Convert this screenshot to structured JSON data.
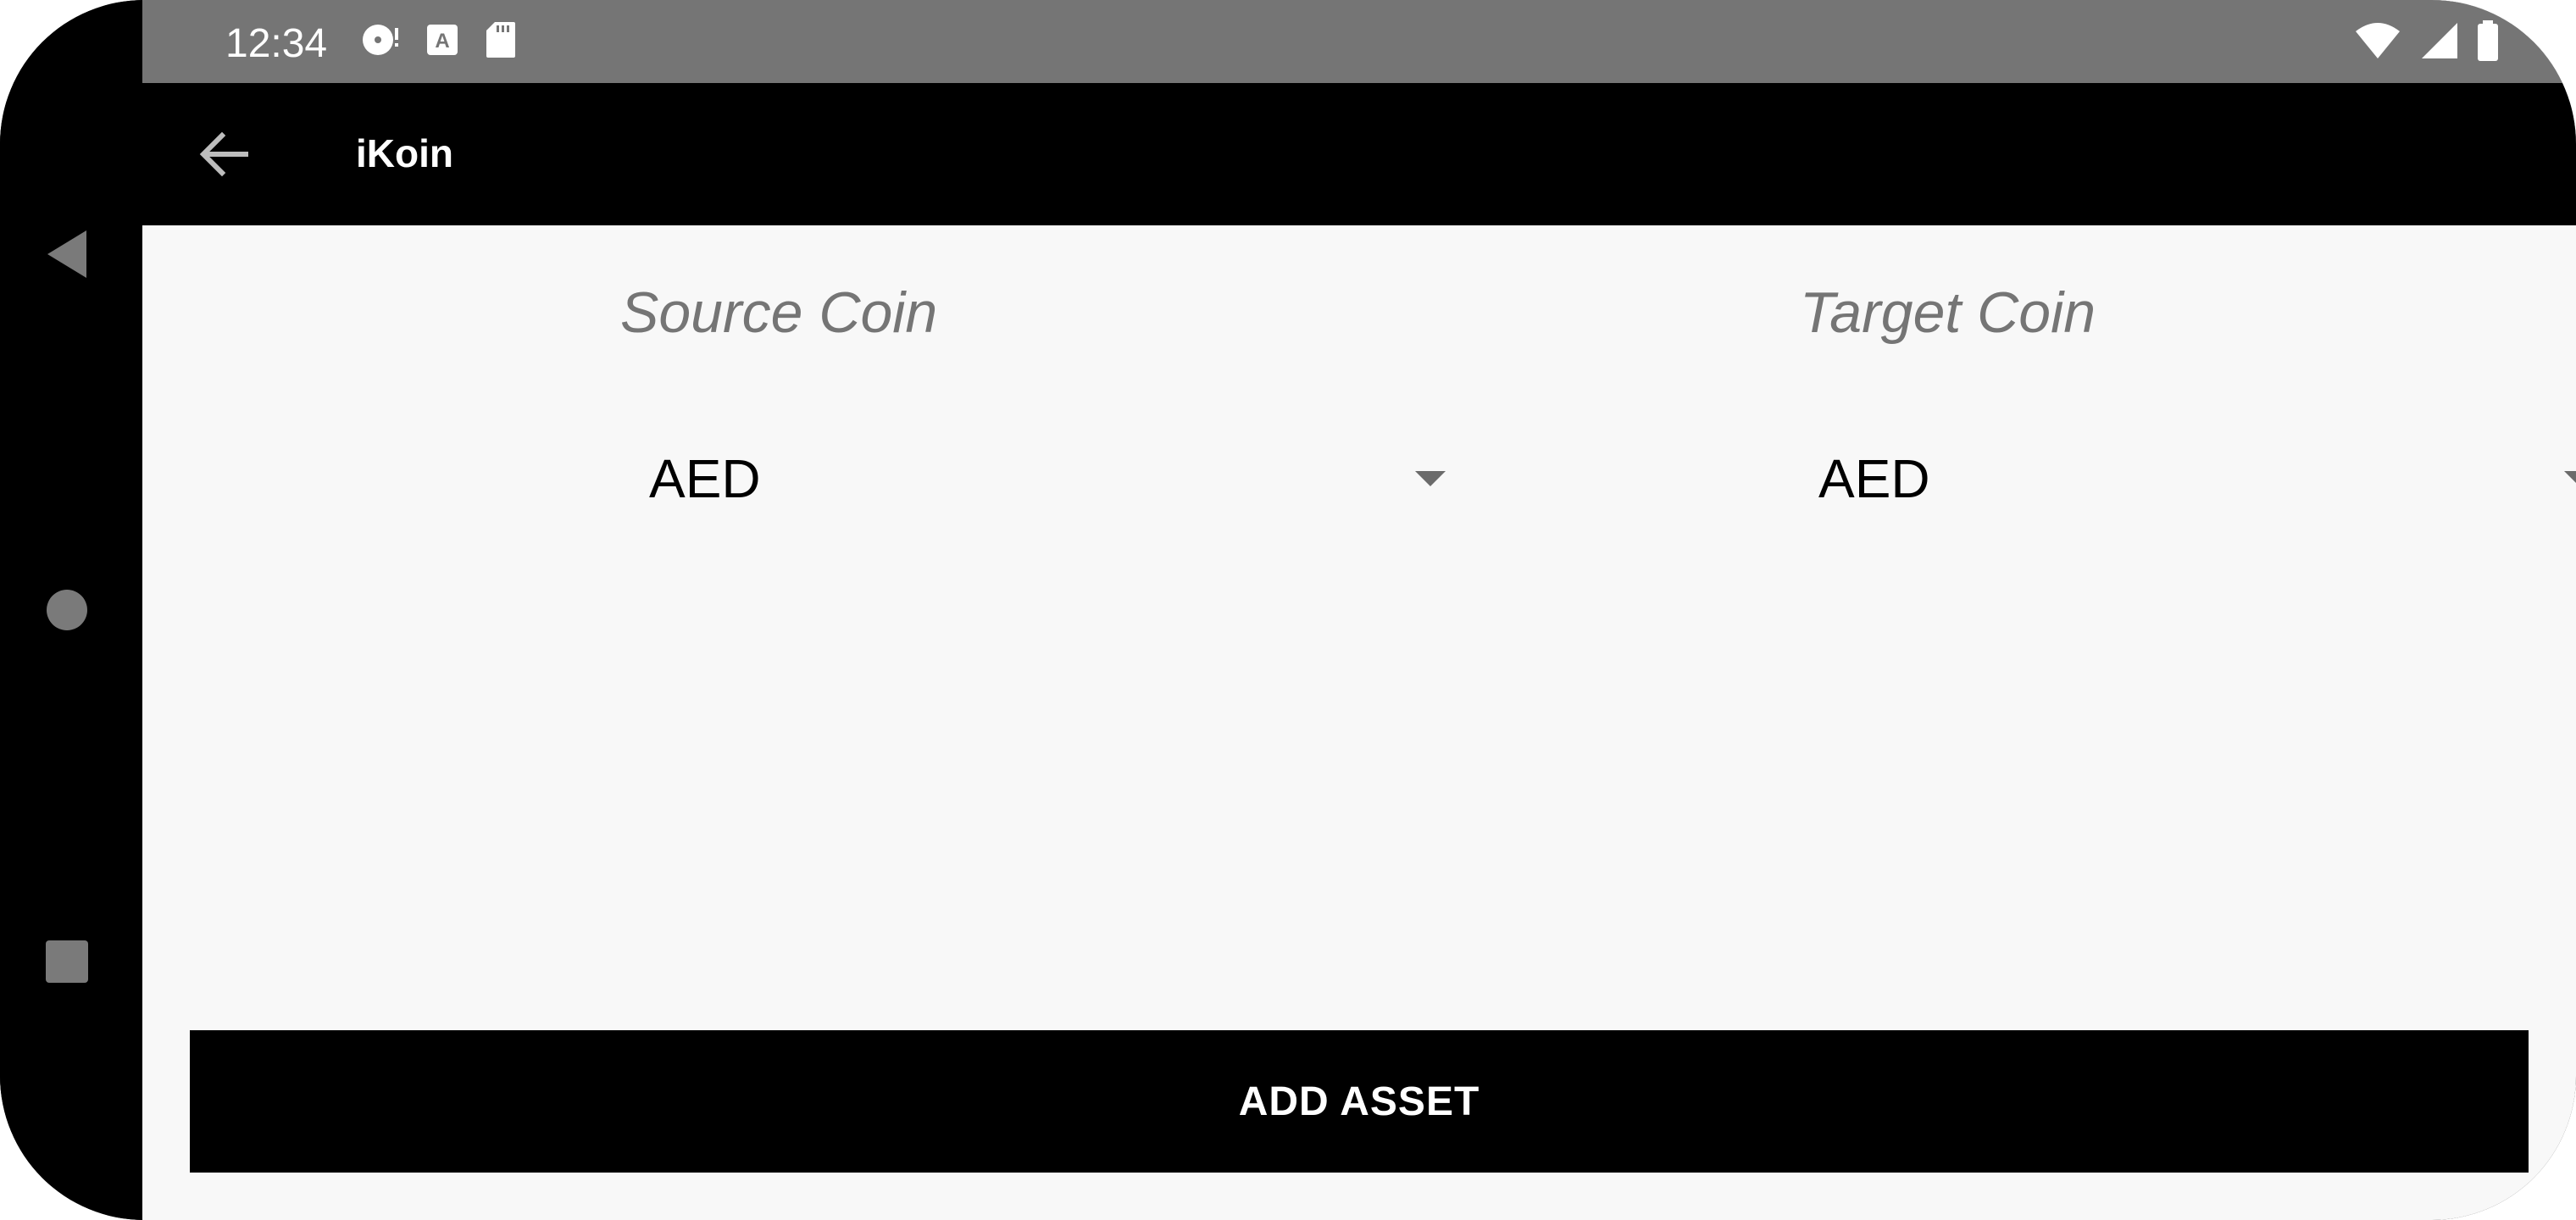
{
  "status_bar": {
    "time": "12:34",
    "left_icons": [
      "media-icon",
      "text-icon",
      "sd-card-icon"
    ],
    "right_icons": [
      "wifi-icon",
      "signal-icon",
      "battery-icon"
    ]
  },
  "app_bar": {
    "title": "iKoin",
    "back_icon": "arrow-back-icon"
  },
  "form": {
    "source_label": "Source Coin",
    "target_label": "Target Coin",
    "source_value": "AED",
    "target_value": "AED"
  },
  "actions": {
    "add_asset_label": "ADD ASSET"
  },
  "nav": {
    "back_icon": "triangle-back-icon",
    "home_icon": "circle-home-icon",
    "recents_icon": "square-recents-icon"
  },
  "colors": {
    "status_bar": "#757575",
    "app_bar": "#000000",
    "background": "#f8f8f8",
    "label": "#757575",
    "button": "#000000"
  }
}
